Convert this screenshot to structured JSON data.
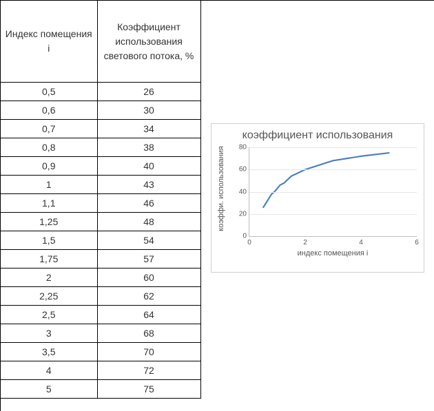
{
  "table": {
    "headers": {
      "col1": "Индекс помещения i",
      "col2": "Коэффициент использования светового потока, %"
    },
    "rows": [
      {
        "i": "0,5",
        "k": "26"
      },
      {
        "i": "0,6",
        "k": "30"
      },
      {
        "i": "0,7",
        "k": "34"
      },
      {
        "i": "0,8",
        "k": "38"
      },
      {
        "i": "0,9",
        "k": "40"
      },
      {
        "i": "1",
        "k": "43"
      },
      {
        "i": "1,1",
        "k": "46"
      },
      {
        "i": "1,25",
        "k": "48"
      },
      {
        "i": "1,5",
        "k": "54"
      },
      {
        "i": "1,75",
        "k": "57"
      },
      {
        "i": "2",
        "k": "60"
      },
      {
        "i": "2,25",
        "k": "62"
      },
      {
        "i": "2,5",
        "k": "64"
      },
      {
        "i": "3",
        "k": "68"
      },
      {
        "i": "3,5",
        "k": "70"
      },
      {
        "i": "4",
        "k": "72"
      },
      {
        "i": "5",
        "k": "75"
      }
    ]
  },
  "chart_data": {
    "type": "line",
    "title": "коэффициент использования",
    "xlabel": "индекс помещения i",
    "ylabel": "коэффи. использования",
    "xlim": [
      0,
      6
    ],
    "ylim": [
      0,
      80
    ],
    "xticks": [
      0,
      2,
      4,
      6
    ],
    "yticks": [
      0,
      20,
      40,
      60,
      80
    ],
    "grid_h": true,
    "series": [
      {
        "name": "коэффициент использования",
        "color": "#4c80c3",
        "x": [
          0.5,
          0.6,
          0.7,
          0.8,
          0.9,
          1.0,
          1.1,
          1.25,
          1.5,
          1.75,
          2.0,
          2.25,
          2.5,
          3.0,
          3.5,
          4.0,
          5.0
        ],
        "y": [
          26,
          30,
          34,
          38,
          40,
          43,
          46,
          48,
          54,
          57,
          60,
          62,
          64,
          68,
          70,
          72,
          75
        ]
      }
    ]
  }
}
